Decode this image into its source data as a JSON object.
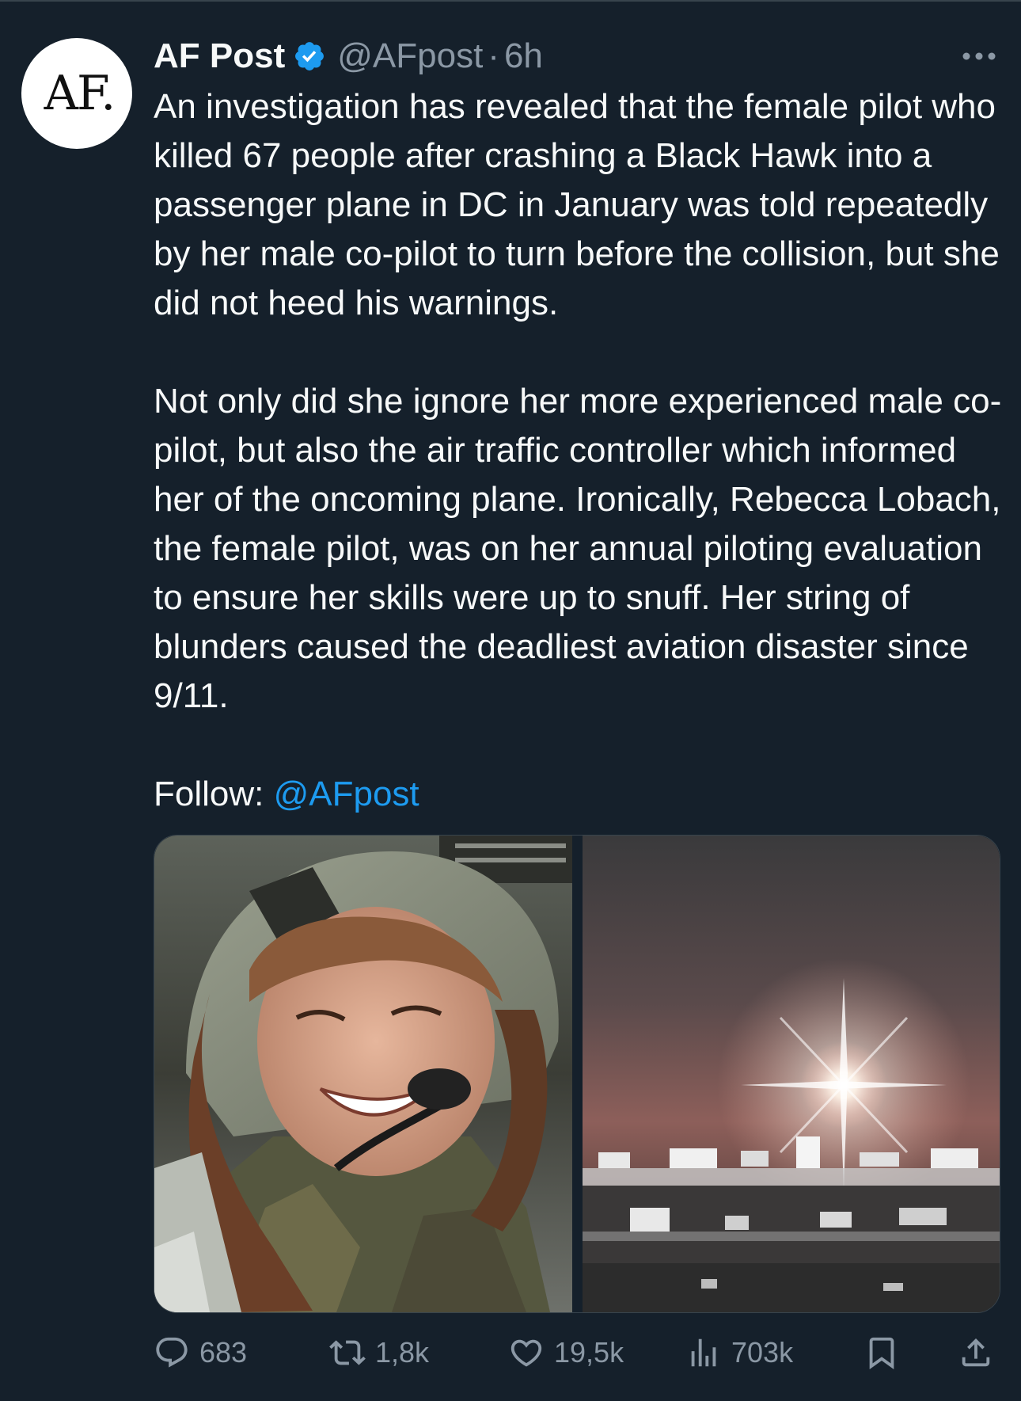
{
  "tweet": {
    "author": {
      "avatar_text": "AF.",
      "display_name": "AF Post",
      "handle": "@AFpost",
      "separator": "·",
      "time": "6h",
      "verified": true
    },
    "body": {
      "paragraph1": "An investigation has revealed that the female pilot who killed 67 people after crashing a Black Hawk into a passenger plane in DC in January was told repeatedly by her male co-pilot to turn before the collision, but she did not heed his warnings.",
      "paragraph2": "Not only did she ignore her more experienced male co-pilot, but also the air traffic controller which informed her of the oncoming plane. Ironically, Rebecca Lobach, the female pilot, was on her annual piloting evaluation to ensure her skills were up to snuff. Her string of blunders caused the deadliest aviation disaster since 9/11.",
      "follow_label": "Follow: ",
      "follow_mention": "@AFpost"
    },
    "actions": {
      "replies": "683",
      "reposts": "1,8k",
      "likes": "19,5k",
      "views": "703k"
    }
  },
  "icons": {
    "verified": "verified-badge-icon",
    "more": "more-icon",
    "reply": "reply-icon",
    "repost": "repost-icon",
    "like": "heart-icon",
    "views": "views-icon",
    "bookmark": "bookmark-icon",
    "share": "share-icon"
  },
  "colors": {
    "background": "#15202b",
    "text": "#f7f9f9",
    "secondary": "#8b98a5",
    "accent": "#1d9bf0",
    "divider": "#38444d"
  }
}
